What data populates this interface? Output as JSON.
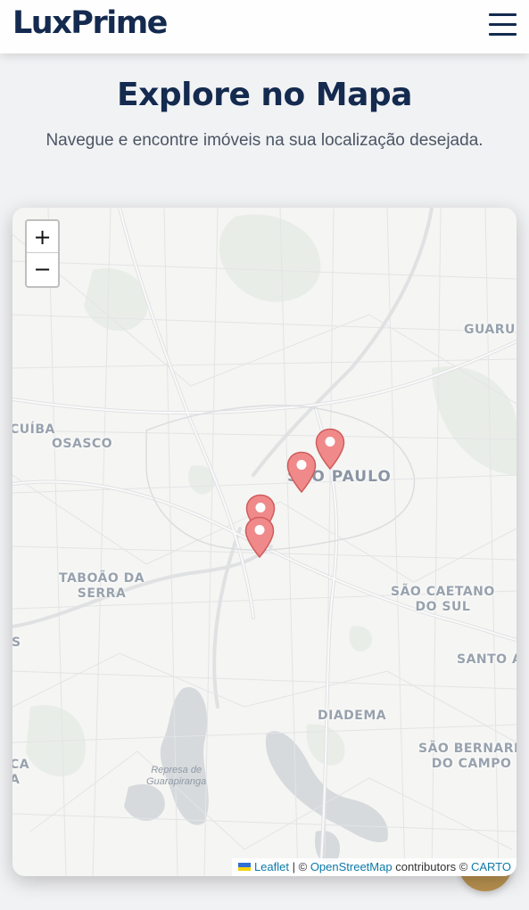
{
  "header": {
    "logo": "LuxPrime",
    "menu_icon": "hamburger-menu-icon"
  },
  "hero": {
    "title": "Explore no Mapa",
    "subtitle": "Navegue e encontre imóveis na sua localização desejada."
  },
  "map": {
    "zoom_in_label": "+",
    "zoom_out_label": "−",
    "places": {
      "guarulhos": "GUARU",
      "carapicuiba": "CUÍBA",
      "osasco": "OSASCO",
      "sao_paulo": "SÃO PAULO",
      "taboao_line1": "TABOÃO DA",
      "taboao_line2": "SERRA",
      "sao_caetano_line1": "SÃO CAETANO",
      "sao_caetano_line2": "DO SUL",
      "left_edge": "S",
      "santo_andre": "SANTO A",
      "diadema": "DIADEMA",
      "itapecerica_line1": "CA",
      "itapecerica_line2": "A",
      "sao_bernardo_line1": "SÃO BERNARD",
      "sao_bernardo_line2": "DO CAMPO",
      "represa_line1": "Represa de",
      "represa_line2": "Guarapiranga"
    },
    "marker_color": "#f08a8a",
    "markers": 4,
    "attribution": {
      "leaflet": "Leaflet",
      "separator": "| ©",
      "osm": "OpenStreetMap",
      "contributors": "contributors ©",
      "carto": "CARTO"
    }
  },
  "colors": {
    "brand": "#142a4f",
    "accent": "#b8914f",
    "background": "#f1f2f4"
  }
}
